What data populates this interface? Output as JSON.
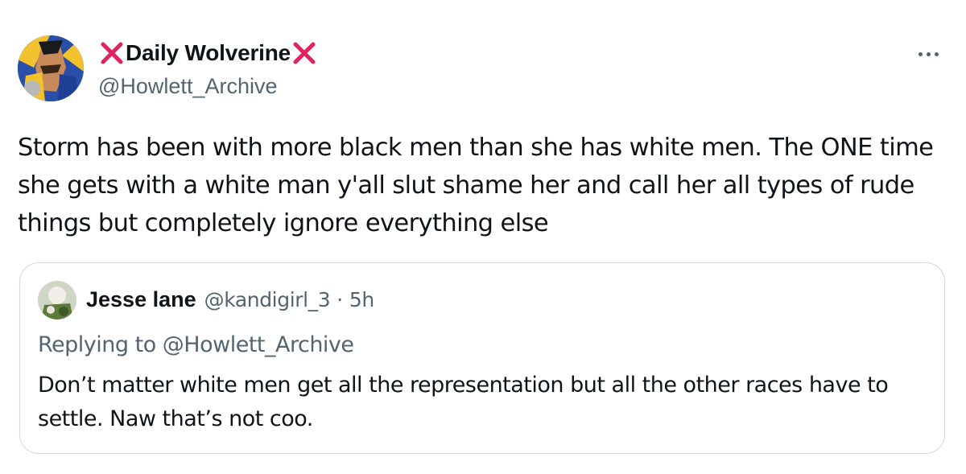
{
  "tweet": {
    "display_name": "Daily Wolverine",
    "handle": "@Howlett_Archive",
    "text": "Storm has been with more black men than she has white men. The ONE time she gets with a white man y'all slut shame her and call her all types of rude things but completely ignore everything else",
    "more_icon": "more-horizontal-icon",
    "name_decoration_icon": "red-x-mark-icon"
  },
  "quote": {
    "display_name": "Jesse lane",
    "handle": "@kandigirl_3",
    "separator": "·",
    "time": "5h",
    "replying_to": "Replying to @Howlett_Archive",
    "text": "Don’t matter white men get all the representation but all the other races have to settle. Naw that’s not coo."
  },
  "colors": {
    "primary_text": "#0f1419",
    "secondary_text": "#536471",
    "border": "#cfd9de",
    "x_mark": "#e0245e"
  }
}
